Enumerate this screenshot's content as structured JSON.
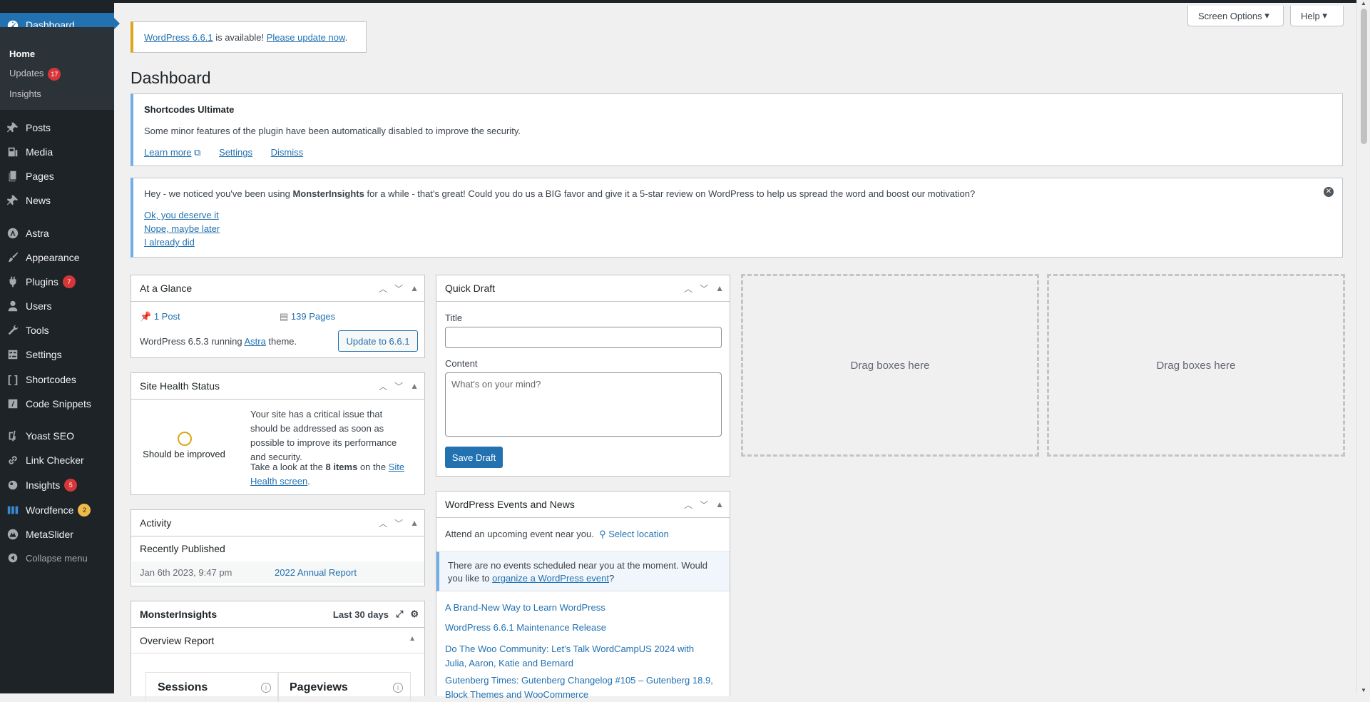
{
  "sidebar": {
    "dashboard": "Dashboard",
    "submenu": [
      {
        "label": "Home"
      },
      {
        "label": "Updates",
        "badge": "17"
      },
      {
        "label": "Insights"
      }
    ],
    "items": [
      {
        "label": "Posts",
        "icon": "pin-icon"
      },
      {
        "label": "Media",
        "icon": "media-icon"
      },
      {
        "label": "Pages",
        "icon": "pages-icon"
      },
      {
        "label": "News",
        "icon": "pin-icon"
      },
      {
        "label": "Astra",
        "icon": "astra-icon"
      },
      {
        "label": "Appearance",
        "icon": "brush-icon"
      },
      {
        "label": "Plugins",
        "icon": "plugin-icon",
        "badge": "7"
      },
      {
        "label": "Users",
        "icon": "users-icon"
      },
      {
        "label": "Tools",
        "icon": "wrench-icon"
      },
      {
        "label": "Settings",
        "icon": "settings-icon"
      },
      {
        "label": "Shortcodes",
        "icon": "brackets-icon"
      },
      {
        "label": "Code Snippets",
        "icon": "code-icon"
      },
      {
        "label": "Yoast SEO",
        "icon": "yoast-icon"
      },
      {
        "label": "Link Checker",
        "icon": "link-icon"
      },
      {
        "label": "Insights",
        "icon": "insights-icon",
        "badge": "5"
      },
      {
        "label": "Wordfence",
        "icon": "wordfence-icon",
        "badge": "2"
      },
      {
        "label": "MetaSlider",
        "icon": "metaslider-icon"
      }
    ],
    "collapse": "Collapse menu"
  },
  "header": {
    "screen_options": "Screen Options",
    "help": "Help"
  },
  "update_notice": {
    "version_link": "WordPress 6.6.1",
    "middle": " is available! ",
    "update_link": "Please update now",
    "end": "."
  },
  "page_title": "Dashboard",
  "shortcodes_notice": {
    "title": "Shortcodes Ultimate",
    "text": "Some minor features of the plugin have been automatically disabled to improve the security.",
    "learn_more": "Learn more",
    "settings": "Settings",
    "dismiss": "Dismiss"
  },
  "monster_notice": {
    "text_pre": "Hey - we noticed you've been using ",
    "brand": "MonsterInsights",
    "text_post": " for a while - that's great! Could you do us a BIG favor and give it a 5-star review on WordPress to help us spread the word and boost our motivation?",
    "link1": "Ok, you deserve it",
    "link2": "Nope, maybe later",
    "link3": "I already did"
  },
  "at_a_glance": {
    "title": "At a Glance",
    "posts": "1 Post",
    "pages": "139 Pages",
    "version_pre": "WordPress 6.5.3 running ",
    "theme": "Astra",
    "version_post": " theme.",
    "update_btn": "Update to 6.6.1"
  },
  "site_health": {
    "title": "Site Health Status",
    "status": "Should be improved",
    "text": "Your site has a critical issue that should be addressed as soon as possible to improve its performance and security.",
    "take_pre": "Take a look at the ",
    "items": "8 items",
    "take_mid": " on the ",
    "link": "Site Health screen",
    "end": "."
  },
  "activity": {
    "title": "Activity",
    "recent": "Recently Published",
    "date": "Jan 6th 2023, 9:47 pm",
    "post": "2022 Annual Report"
  },
  "monsterinsights": {
    "title": "MonsterInsights",
    "range": "Last 30 days",
    "overview": "Overview Report",
    "sessions": "Sessions",
    "pageviews": "Pageviews"
  },
  "quick_draft": {
    "title": "Quick Draft",
    "title_label": "Title",
    "content_label": "Content",
    "content_placeholder": "What's on your mind?",
    "save": "Save Draft"
  },
  "events": {
    "title": "WordPress Events and News",
    "attend": "Attend an upcoming event near you.",
    "select_location": "Select location",
    "no_events_pre": "There are no events scheduled near you at the moment. Would you like to ",
    "no_events_link": "organize a WordPress event",
    "no_events_end": "?",
    "news": [
      "A Brand-New Way to Learn WordPress",
      "WordPress 6.6.1 Maintenance Release",
      "Do The Woo Community: Let's Talk WordCampUS 2024 with Julia, Aaron, Katie and Bernard",
      "Gutenberg Times: Gutenberg Changelog #105 – Gutenberg 18.9, Block Themes and WooCommerce"
    ]
  },
  "drag_boxes": "Drag boxes here",
  "colors": {
    "sidebar": "#1d2327",
    "accent": "#2271b1",
    "badge": "#d63638"
  }
}
